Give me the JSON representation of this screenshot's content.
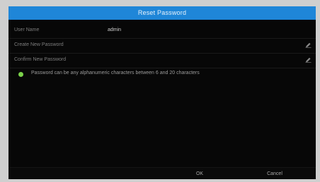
{
  "dialog": {
    "title": "Reset Password",
    "fields": [
      {
        "label": "User Name",
        "value": "admin"
      },
      {
        "label": "Create New Password",
        "value": ""
      },
      {
        "label": "Confirm New Password",
        "value": ""
      }
    ],
    "hint": "Password can be any alphanumeric characters between 6 and 20 characters",
    "ok_label": "OK",
    "cancel_label": "Cancel",
    "icons": {
      "edit": "pencil-icon",
      "hint_indicator": "green-dot-icon"
    },
    "colors": {
      "titlebar": "#1f86d8",
      "background": "#070707",
      "hint_dot": "#7bd24a"
    }
  }
}
